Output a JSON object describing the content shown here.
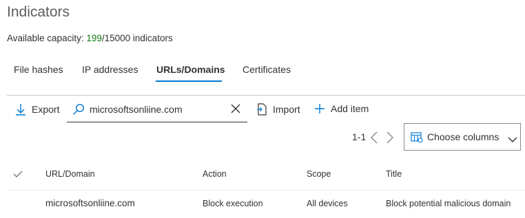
{
  "page": {
    "title": "Indicators"
  },
  "capacity": {
    "label": "Available capacity:",
    "used": "199",
    "rest": "/15000 indicators"
  },
  "tabs": [
    {
      "label": "File hashes"
    },
    {
      "label": "IP addresses"
    },
    {
      "label": "URLs/Domains",
      "active": true
    },
    {
      "label": "Certificates"
    }
  ],
  "toolbar": {
    "export_label": "Export",
    "search_value": "microsoftsonliine.com",
    "import_label": "Import",
    "add_item_label": "Add item"
  },
  "pager": {
    "range": "1-1"
  },
  "choose_columns": {
    "label": "Choose columns"
  },
  "table": {
    "headers": [
      "URL/Domain",
      "Action",
      "Scope",
      "Title"
    ],
    "rows": [
      [
        "microsoftsonliine.com",
        "Block execution",
        "All devices",
        "Block potential malicious domain"
      ]
    ]
  },
  "colors": {
    "accent": "#0078d4",
    "capacity_used": "#107c10"
  },
  "icons": [
    "download-icon",
    "search-icon",
    "close-icon",
    "import-icon",
    "plus-icon",
    "chevron-left-icon",
    "chevron-right-icon",
    "columns-icon",
    "chevron-down-icon",
    "checkmark-icon"
  ]
}
